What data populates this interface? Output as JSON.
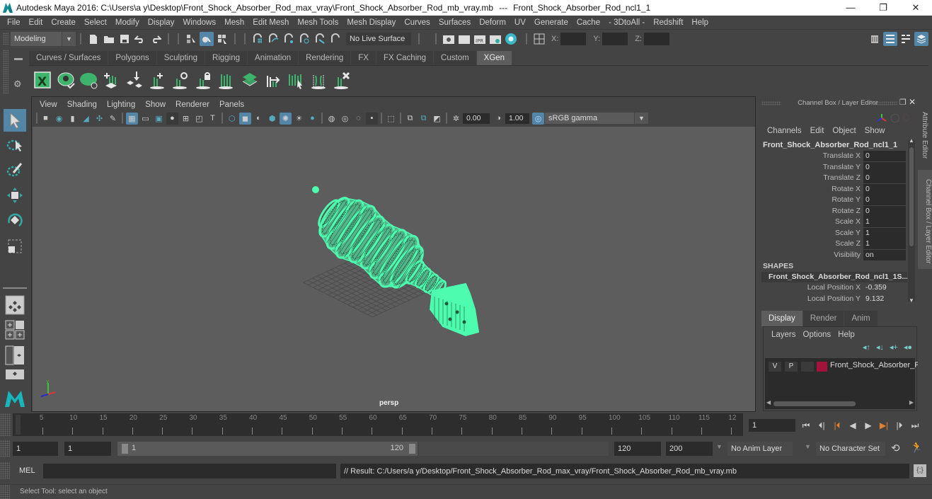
{
  "window": {
    "title_left": "Autodesk Maya 2016: C:\\Users\\a y\\Desktop\\Front_Shock_Absorber_Rod_max_vray\\Front_Shock_Absorber_Rod_mb_vray.mb",
    "title_sep": "---",
    "title_right": "Front_Shock_Absorber_Rod_ncl1_1",
    "controls": {
      "minimize": "—",
      "restore": "❐",
      "close": "✕"
    }
  },
  "menubar": [
    "File",
    "Edit",
    "Create",
    "Select",
    "Modify",
    "Display",
    "Windows",
    "Mesh",
    "Edit Mesh",
    "Mesh Tools",
    "Mesh Display",
    "Curves",
    "Surfaces",
    "Deform",
    "UV",
    "Generate",
    "Cache",
    "- 3DtoAll -",
    "Redshift",
    "Help"
  ],
  "statusline": {
    "menuset": "Modeling",
    "live_surface": "No Live Surface",
    "x_label": "X:",
    "y_label": "Y:",
    "z_label": "Z:",
    "x_value": "",
    "y_value": "",
    "z_value": ""
  },
  "shelf": {
    "tabs": [
      "Curves / Surfaces",
      "Polygons",
      "Sculpting",
      "Rigging",
      "Animation",
      "Rendering",
      "FX",
      "FX Caching",
      "Custom",
      "XGen"
    ],
    "active_tab": "XGen",
    "icons": [
      "xgen-editor-icon",
      "xgen-preview-icon",
      "xgen-clear-preview-icon",
      "xgen-add-guides-icon",
      "xgen-place-guides-icon",
      "xgen-add-guide-icon",
      "xgen-sculpt-guide-icon",
      "xgen-lock-guide-icon",
      "xgen-guide-rebuild-icon",
      "xgen-patch-icon",
      "xgen-length-icon",
      "xgen-select-guides-icon",
      "xgen-guide-bend-icon",
      "xgen-delete-guide-icon"
    ]
  },
  "viewport": {
    "menu": [
      "View",
      "Shading",
      "Lighting",
      "Show",
      "Renderer",
      "Panels"
    ],
    "exposure": "0.00",
    "gamma": "1.00",
    "color_space": "sRGB gamma",
    "camera_label": "persp",
    "axis": {
      "x": "x",
      "y": "y",
      "z": "z"
    },
    "wire_color": "#4dfcae"
  },
  "channel_box": {
    "header": "Channel Box / Layer Editor",
    "menu": [
      "Channels",
      "Edit",
      "Object",
      "Show"
    ],
    "object_name": "Front_Shock_Absorber_Rod_ncl1_1",
    "attributes": [
      {
        "label": "Translate X",
        "value": "0"
      },
      {
        "label": "Translate Y",
        "value": "0"
      },
      {
        "label": "Translate Z",
        "value": "0"
      },
      {
        "label": "Rotate X",
        "value": "0"
      },
      {
        "label": "Rotate Y",
        "value": "0"
      },
      {
        "label": "Rotate Z",
        "value": "0"
      },
      {
        "label": "Scale X",
        "value": "1"
      },
      {
        "label": "Scale Y",
        "value": "1"
      },
      {
        "label": "Scale Z",
        "value": "1"
      },
      {
        "label": "Visibility",
        "value": "on"
      }
    ],
    "shapes_header": "SHAPES",
    "shape_name": "Front_Shock_Absorber_Rod_ncl1_1S...",
    "shape_attributes": [
      {
        "label": "Local Position X",
        "value": "-0.359"
      },
      {
        "label": "Local Position Y",
        "value": "9.132"
      }
    ]
  },
  "layer_editor": {
    "tabs": [
      "Display",
      "Render",
      "Anim"
    ],
    "active_tab": "Display",
    "menu": [
      "Layers",
      "Options",
      "Help"
    ],
    "layers": [
      {
        "v": "V",
        "p": "P",
        "name": "Front_Shock_Absorber_F",
        "color": "#a3123a"
      }
    ]
  },
  "side_tabs": [
    "Attribute Editor",
    "Channel Box / Layer Editor"
  ],
  "timeline": {
    "start_label": "1",
    "ticks": [
      5,
      10,
      15,
      20,
      25,
      30,
      35,
      40,
      45,
      50,
      55,
      60,
      65,
      70,
      75,
      80,
      85,
      90,
      95,
      100,
      105,
      110,
      115,
      "12"
    ],
    "current_frame": "1"
  },
  "range": {
    "start_time": "1",
    "playback_start": "1",
    "slider_min_label": "1",
    "slider_max_label": "120",
    "playback_end": "120",
    "end_time": "200",
    "anim_layer": "No Anim Layer",
    "character_set": "No Character Set"
  },
  "command_line": {
    "mode": "MEL",
    "input": "",
    "result": "// Result: C:/Users/a y/Desktop/Front_Shock_Absorber_Rod_max_vray/Front_Shock_Absorber_Rod_mb_vray.mb"
  },
  "help_line": "Select Tool: select an object"
}
